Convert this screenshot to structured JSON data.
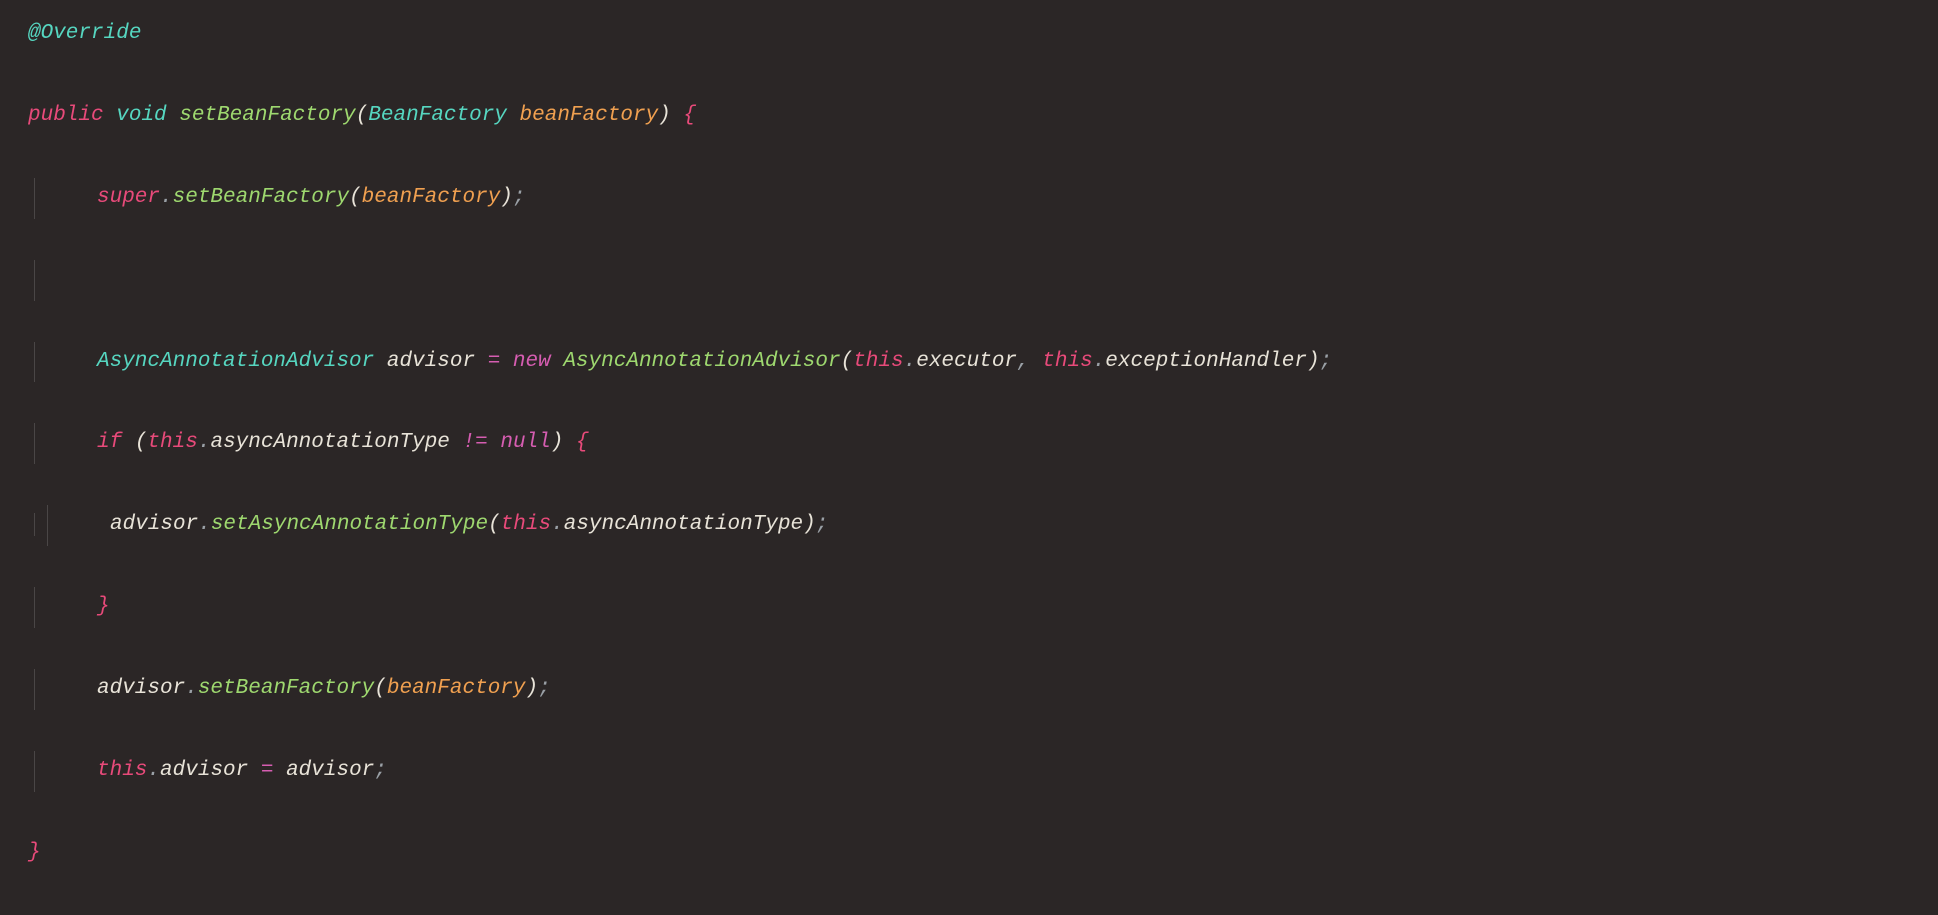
{
  "code": {
    "override": "@Override",
    "kw_public": "public",
    "kw_void": "void",
    "method_setBeanFactory": "setBeanFactory",
    "type_BeanFactory": "BeanFactory",
    "param_beanFactory": "beanFactory",
    "kw_super": "super",
    "type_AsyncAnnotationAdvisor": "AsyncAnnotationAdvisor",
    "var_advisor": "advisor",
    "kw_new": "new",
    "ctor_AsyncAnnotationAdvisor": "AsyncAnnotationAdvisor",
    "kw_this": "this",
    "prop_executor": "executor",
    "prop_exceptionHandler": "exceptionHandler",
    "kw_if": "if",
    "prop_asyncAnnotationType": "asyncAnnotationType",
    "op_neq": "!=",
    "kw_null": "null",
    "method_setAsyncAnnotationType": "setAsyncAnnotationType",
    "prop_advisor": "advisor",
    "op_assign": "=",
    "lbrace": "{",
    "rbrace": "}",
    "lparen": "(",
    "rparen": ")",
    "semi": ";",
    "comma": ",",
    "dot": "."
  }
}
